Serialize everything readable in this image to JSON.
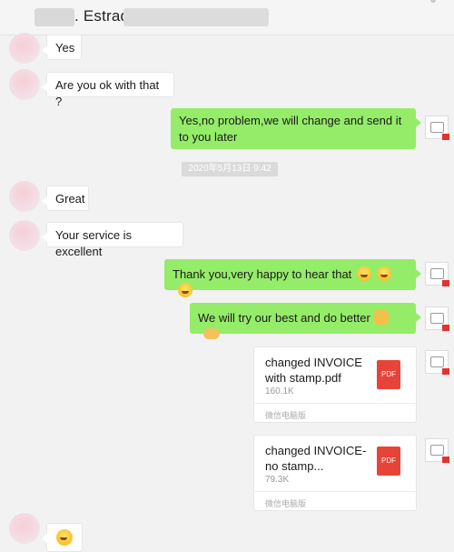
{
  "header": {
    "contact_name": ". Estrad"
  },
  "timestamp": "2020年5月13日 9:42",
  "messages": {
    "m1": "Yes",
    "m2": "Are you ok with that ?",
    "m3": "Yes,no problem,we will change and send it to you later",
    "m4": "Great",
    "m5": "Your service is excellent",
    "m6": "Thank you,very happy to hear that",
    "m7": "We will try our best and do better"
  },
  "files": [
    {
      "name": "changed INVOICE with stamp.pdf",
      "size": "160.1K",
      "source": "微信电脑版",
      "type_label": "PDF"
    },
    {
      "name": "changed INVOICE-no stamp...",
      "size": "79.3K",
      "source": "微信电脑版",
      "type_label": "PDF"
    }
  ],
  "icons": {
    "emoji_grin": "grinning-face",
    "emoji_fist": "raised-fist",
    "emoji_handshake": "handshake",
    "emoji_smile": "smiling-face"
  },
  "colors": {
    "sent_bubble": "#95ec69",
    "received_bubble": "#ffffff",
    "pdf_red": "#e84338"
  }
}
